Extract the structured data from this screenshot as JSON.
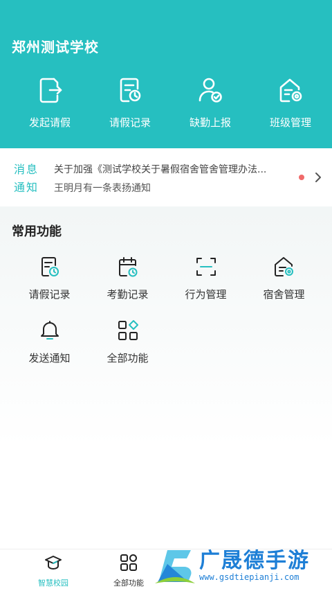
{
  "header": {
    "school_name": "郑州测试学校",
    "actions": [
      {
        "label": "发起请假",
        "icon": "leave-request-icon"
      },
      {
        "label": "请假记录",
        "icon": "leave-record-icon"
      },
      {
        "label": "缺勤上报",
        "icon": "absence-report-icon"
      },
      {
        "label": "班级管理",
        "icon": "class-management-icon"
      }
    ]
  },
  "notice": {
    "tag_top": "消息",
    "tag_bottom": "通知",
    "line1": "关于加强《测试学校关于暑假宿舍管舍管理办法...",
    "line2": "王明月有一条表扬通知"
  },
  "common": {
    "title": "常用功能",
    "items": [
      {
        "label": "请假记录",
        "icon": "leave-record-icon"
      },
      {
        "label": "考勤记录",
        "icon": "attendance-record-icon"
      },
      {
        "label": "行为管理",
        "icon": "behavior-scan-icon"
      },
      {
        "label": "宿舍管理",
        "icon": "dorm-management-icon"
      },
      {
        "label": "发送通知",
        "icon": "bell-icon"
      },
      {
        "label": "全部功能",
        "icon": "all-functions-icon"
      }
    ]
  },
  "tabbar": {
    "tabs": [
      {
        "label": "智慧校园",
        "icon": "graduation-cap-icon",
        "active": true
      },
      {
        "label": "全部功能",
        "icon": "grid-icon",
        "active": false
      }
    ]
  },
  "watermark": {
    "text": "广晟德手游",
    "url": "www.gsdtiepianji.com"
  },
  "colors": {
    "accent": "#26bfc0",
    "notice_dot": "#f06a6a",
    "watermark": "#1e7fd6"
  }
}
